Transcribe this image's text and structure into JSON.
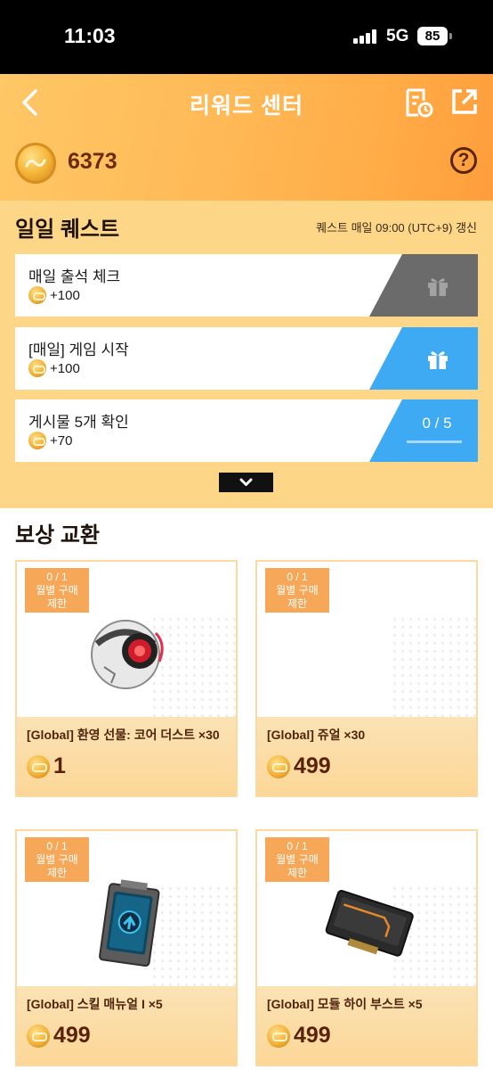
{
  "status_bar": {
    "time": "11:03",
    "network": "5G",
    "battery": "85"
  },
  "header": {
    "title": "리워드 센터",
    "balance": "6373"
  },
  "quests": {
    "title": "일일 퀘스트",
    "reset_note": "퀘스트 매일 09:00 (UTC+9) 갱신",
    "items": [
      {
        "name": "매일 출석 체크",
        "reward": "+100",
        "state": "claimed"
      },
      {
        "name": "[매일] 게임 시작",
        "reward": "+100",
        "state": "claimable"
      },
      {
        "name": "게시물 5개 확인",
        "reward": "+70",
        "state": "in_progress",
        "progress": "0 / 5",
        "progress_fraction": 0
      }
    ]
  },
  "exchange": {
    "title": "보상 교환",
    "products": [
      {
        "limit_count": "0 / 1",
        "limit_label": "월별 구매",
        "limit_label2": "제한",
        "name": "[Global] 환영 선물: 코어 더스트 ×30",
        "price": "1",
        "image": "core-dust-orb"
      },
      {
        "limit_count": "0 / 1",
        "limit_label": "월별 구매",
        "limit_label2": "제한",
        "name": "[Global] 쥬얼 ×30",
        "price": "499",
        "image": "none"
      },
      {
        "limit_count": "0 / 1",
        "limit_label": "월별 구매",
        "limit_label2": "제한",
        "name": "[Global] 스킬 매뉴얼 I ×5",
        "price": "499",
        "image": "skill-manual-device"
      },
      {
        "limit_count": "0 / 1",
        "limit_label": "월별 구매",
        "limit_label2": "제한",
        "name": "[Global] 모듈 하이 부스트 ×5",
        "price": "499",
        "image": "module-chip"
      }
    ]
  },
  "colors": {
    "header_orange": "#ffad48",
    "panel": "#fdd787",
    "claim_blue": "#3eaaf3",
    "claimed_gray": "#6b6b6b",
    "price_brown": "#5a220a"
  }
}
